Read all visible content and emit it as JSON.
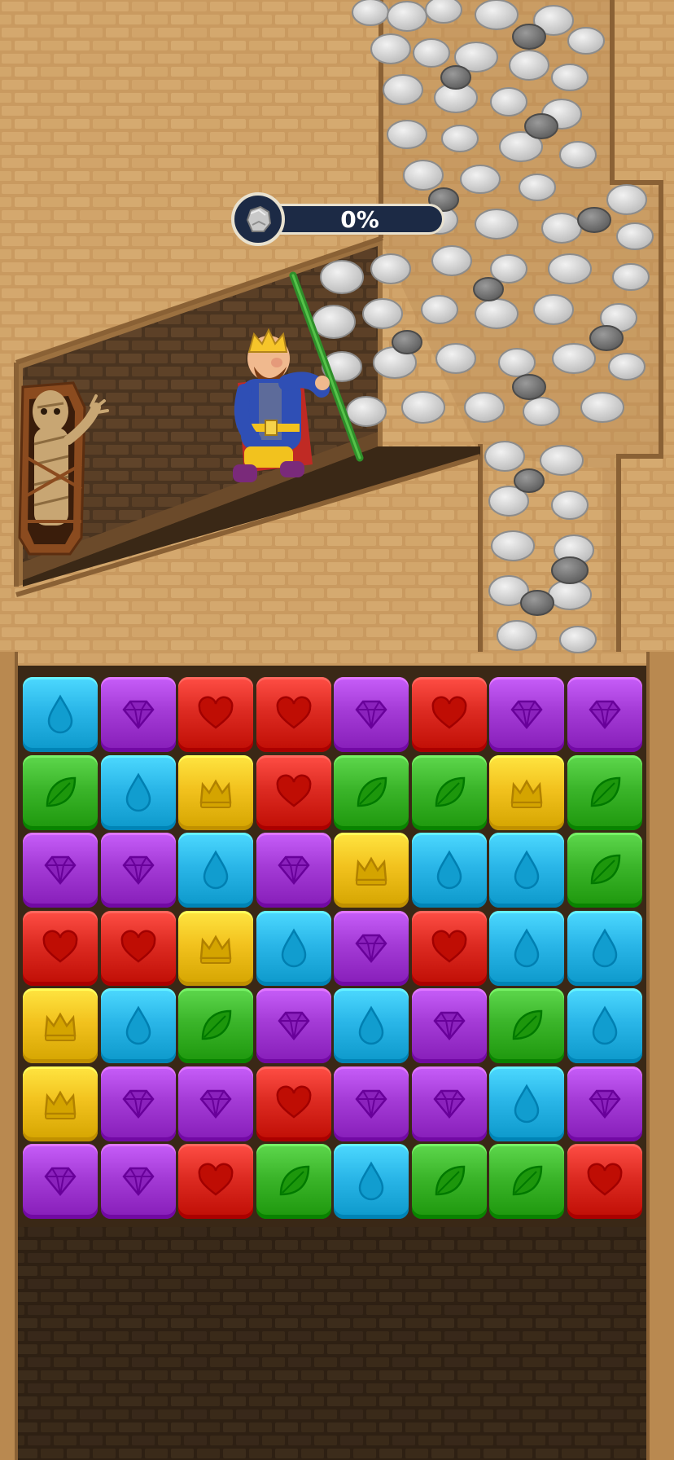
{
  "progress": {
    "percent_label": "0%",
    "value": 0,
    "icon": "rock-icon"
  },
  "board": {
    "rows": 7,
    "cols": 8,
    "tiles": [
      [
        "drop",
        "gem",
        "heart",
        "heart",
        "gem",
        "heart",
        "gem",
        "gem"
      ],
      [
        "leaf",
        "drop",
        "crown",
        "heart",
        "leaf",
        "leaf",
        "crown",
        "leaf"
      ],
      [
        "gem",
        "gem",
        "drop",
        "gem",
        "crown",
        "drop",
        "drop",
        "leaf"
      ],
      [
        "heart",
        "heart",
        "crown",
        "drop",
        "gem",
        "heart",
        "drop",
        "drop"
      ],
      [
        "crown",
        "drop",
        "leaf",
        "gem",
        "drop",
        "gem",
        "leaf",
        "drop"
      ],
      [
        "crown",
        "gem",
        "gem",
        "heart",
        "gem",
        "gem",
        "drop",
        "gem"
      ],
      [
        "gem",
        "gem",
        "heart",
        "leaf",
        "drop",
        "leaf",
        "leaf",
        "heart"
      ]
    ]
  },
  "colors": {
    "drop": "#2ab6e8",
    "gem": "#a43bd6",
    "heart": "#dd2b22",
    "leaf": "#3bb52a",
    "crown": "#f2c21e"
  },
  "scene": {
    "characters": [
      "king",
      "mummy-in-coffin"
    ],
    "obstacle": "boulders",
    "pin": "green-pin"
  }
}
